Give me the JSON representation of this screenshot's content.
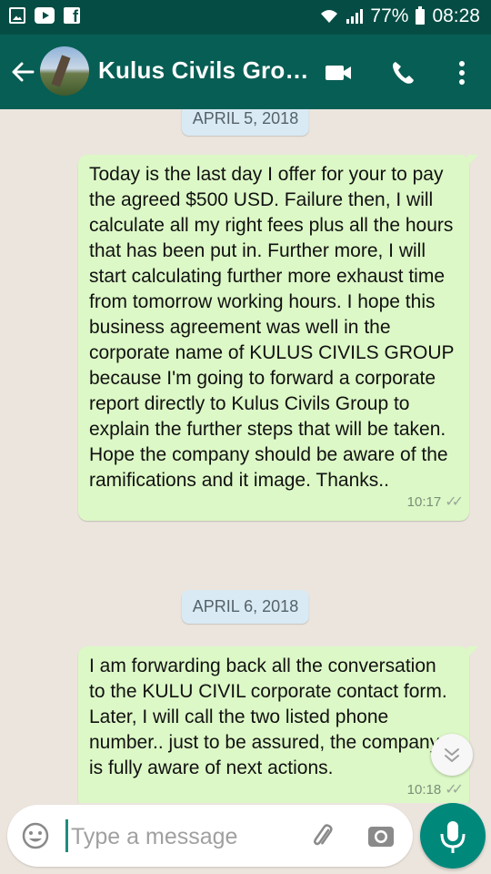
{
  "status_bar": {
    "battery_text": "77%",
    "time": "08:28"
  },
  "header": {
    "title": "Kulus Civils Grou…",
    "colors": {
      "header_bg": "#075e54",
      "status_bg": "#054d44"
    }
  },
  "messages": [
    {
      "date_label": "APRIL 5, 2018",
      "text": "Today is the last day I offer for your to pay the agreed $500 USD. Failure then, I will calculate all my right fees plus all the hours that has been put in. Further more, I will start calculating further more exhaust time from tomorrow working hours. I hope this business agreement was well in the corporate name of KULUS CIVILS GROUP because I'm going to forward a corporate report directly to Kulus Civils Group  to explain the further steps that will be taken. Hope the company should be aware of the ramifications and it image. Thanks..",
      "time": "10:17"
    },
    {
      "date_label": "APRIL 6, 2018",
      "text": "I am forwarding back all the conversation to the KULU CIVIL corporate contact form. Later, I will call the two listed phone number.. just to be assured, the company is fully aware of next actions.",
      "time": "10:18"
    }
  ],
  "composer": {
    "placeholder": "Type a message"
  },
  "colors": {
    "outgoing_bubble": "#dcf8c6",
    "date_chip": "#d9eaf4",
    "accent": "#00897b"
  }
}
